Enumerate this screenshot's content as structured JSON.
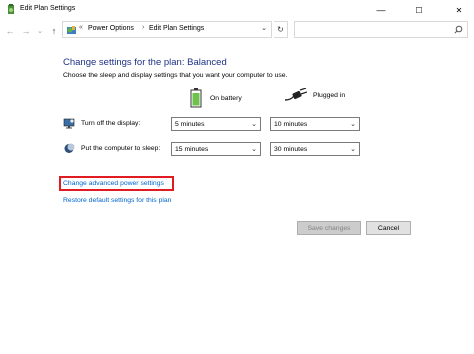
{
  "window": {
    "title": "Edit Plan Settings",
    "minimize": "—",
    "maximize": "☐",
    "close": "✕"
  },
  "nav": {
    "back": "←",
    "forward": "→",
    "recent": "⌄",
    "up": "↑",
    "address": {
      "overflow": "«",
      "crumbs": [
        "Power Options",
        "Edit Plan Settings"
      ],
      "separator": "›",
      "dropdown": "⌄",
      "refresh": "↻"
    },
    "search_placeholder": ""
  },
  "main": {
    "heading": "Change settings for the plan: Balanced",
    "subtext": "Choose the sleep and display settings that you want your computer to use.",
    "columns": {
      "battery": "On battery",
      "plugged": "Plugged in"
    },
    "rows": [
      {
        "label": "Turn off the display:",
        "battery": "5 minutes",
        "plugged": "10 minutes"
      },
      {
        "label": "Put the computer to sleep:",
        "battery": "15 minutes",
        "plugged": "30 minutes"
      }
    ],
    "links": {
      "advanced": "Change advanced power settings",
      "restore": "Restore default settings for this plan"
    },
    "buttons": {
      "save": "Save changes",
      "cancel": "Cancel"
    }
  },
  "colors": {
    "heading": "#1e3287",
    "link": "#0066cc",
    "highlight": "#e11b22"
  }
}
